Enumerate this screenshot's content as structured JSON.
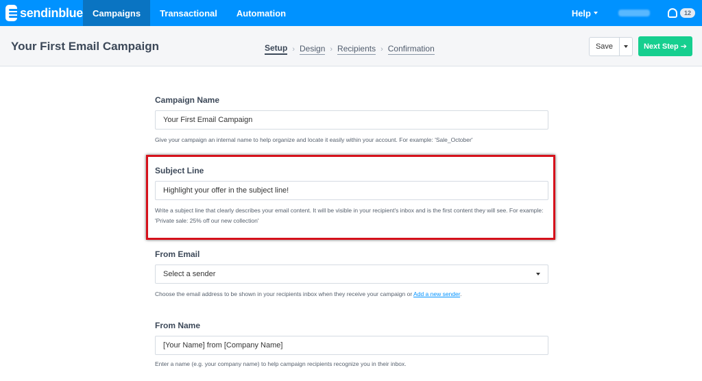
{
  "brand": {
    "name": "sendinblue"
  },
  "nav": {
    "items": [
      {
        "label": "Campaigns",
        "active": true
      },
      {
        "label": "Transactional",
        "active": false
      },
      {
        "label": "Automation",
        "active": false
      }
    ],
    "help_label": "Help",
    "notifications_count": "12"
  },
  "header": {
    "title": "Your First Email Campaign",
    "steps": [
      "Setup",
      "Design",
      "Recipients",
      "Confirmation"
    ],
    "save_label": "Save",
    "next_label": "Next Step ➔"
  },
  "form": {
    "campaign_name": {
      "label": "Campaign Name",
      "value": "Your First Email Campaign",
      "help": "Give your campaign an internal name to help organize and locate it easily within your account. For example: 'Sale_October'"
    },
    "subject_line": {
      "label": "Subject Line",
      "value": "Highlight your offer in the subject line!",
      "help": "Write a subject line that clearly describes your email content. It will be visible in your recipient's inbox and is the first content they will see. For example: 'Private sale: 25% off our new collection'"
    },
    "from_email": {
      "label": "From Email",
      "value": "Select a sender",
      "help": "Choose the email address to be shown in your recipients inbox when they receive your campaign or ",
      "help_link": "Add a new sender",
      "help_suffix": "."
    },
    "from_name": {
      "label": "From Name",
      "value": "[Your Name] from [Company Name]",
      "help": "Enter a name (e.g. your company name) to help campaign recipients recognize you in their inbox."
    }
  },
  "colors": {
    "nav_bg": "#0092ff",
    "nav_active": "#0a74c2",
    "next_button": "#16cf8f",
    "highlight_border": "#d6111b"
  },
  "icons": [
    "sendinblue-logo-icon",
    "caret-down-icon",
    "bell-icon",
    "arrow-right-icon",
    "chevron-right-icon"
  ]
}
